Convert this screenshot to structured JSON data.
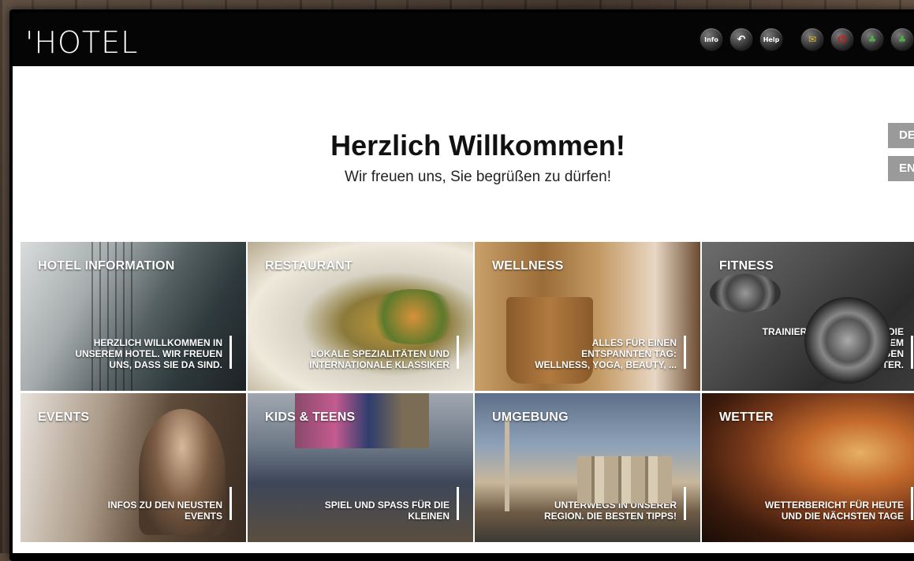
{
  "header": {
    "logo": "'HOTEL",
    "icons": [
      {
        "name": "info-home-icon",
        "label": "Info"
      },
      {
        "name": "back-icon",
        "label": "↶"
      },
      {
        "name": "help-icon",
        "label": "Help"
      },
      {
        "name": "mail-icon",
        "label": "✉"
      },
      {
        "name": "power-icon",
        "label": "⏻"
      },
      {
        "name": "leaf-icon",
        "label": "♣"
      },
      {
        "name": "leaf-icon-2",
        "label": "♣"
      }
    ]
  },
  "welcome": {
    "title": "Herzlich Willkommen!",
    "subtitle": "Wir freuen uns, Sie begrüßen zu dürfen!"
  },
  "languages": {
    "de": "DE",
    "en": "EN"
  },
  "tiles": [
    {
      "title": "HOTEL INFORMATION",
      "desc": "HERZLICH WILLKOMMEN IN\nUNSEREM HOTEL. WIR FREUEN\nUNS, DASS SIE DA SIND."
    },
    {
      "title": "RESTAURANT",
      "desc": "LOKALE SPEZIALITÄTEN UND\nINTERNATIONALE KLASSIKER"
    },
    {
      "title": "WELLNESS",
      "desc": "ALLES FÜR EINEN\nENTSPANNTEN TAG:\nWELLNESS, YOGA, BEAUTY, ..."
    },
    {
      "title": "FITNESS",
      "desc": "TRAINIEREN SIE RUND UM DIE\nUHR IN UNSEREM\nWEITRÄUMIGEN\nFITNESSCENTER."
    },
    {
      "title": "EVENTS",
      "desc": "INFOS ZU DEN NEUSTEN\nEVENTS"
    },
    {
      "title": "KIDS & TEENS",
      "desc": "SPIEL UND SPASS FÜR DIE\nKLEINEN"
    },
    {
      "title": "UMGEBUNG",
      "desc": "UNTERWEGS IN UNSERER\nREGION. DIE BESTEN TIPPS!"
    },
    {
      "title": "WETTER",
      "desc": "WETTERBERICHT FÜR HEUTE\nUND DIE NÄCHSTEN TAGE"
    }
  ]
}
